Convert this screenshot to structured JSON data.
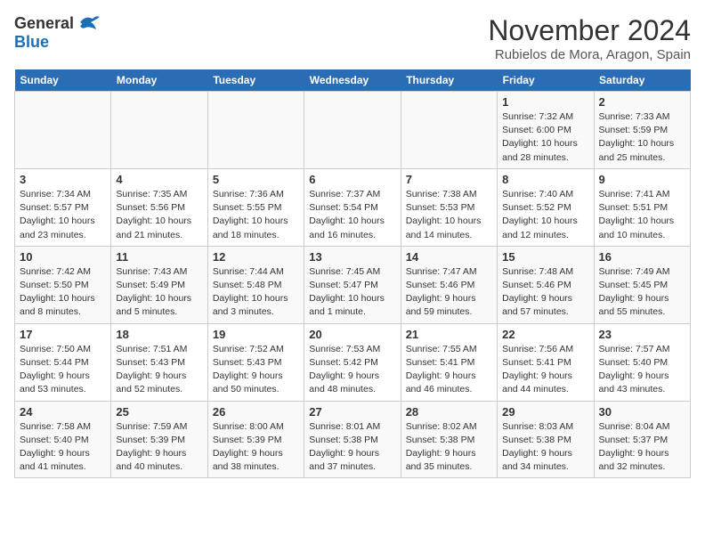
{
  "logo": {
    "general": "General",
    "blue": "Blue"
  },
  "title": "November 2024",
  "location": "Rubielos de Mora, Aragon, Spain",
  "weekdays": [
    "Sunday",
    "Monday",
    "Tuesday",
    "Wednesday",
    "Thursday",
    "Friday",
    "Saturday"
  ],
  "weeks": [
    [
      {
        "day": "",
        "info": ""
      },
      {
        "day": "",
        "info": ""
      },
      {
        "day": "",
        "info": ""
      },
      {
        "day": "",
        "info": ""
      },
      {
        "day": "",
        "info": ""
      },
      {
        "day": "1",
        "info": "Sunrise: 7:32 AM\nSunset: 6:00 PM\nDaylight: 10 hours and 28 minutes."
      },
      {
        "day": "2",
        "info": "Sunrise: 7:33 AM\nSunset: 5:59 PM\nDaylight: 10 hours and 25 minutes."
      }
    ],
    [
      {
        "day": "3",
        "info": "Sunrise: 7:34 AM\nSunset: 5:57 PM\nDaylight: 10 hours and 23 minutes."
      },
      {
        "day": "4",
        "info": "Sunrise: 7:35 AM\nSunset: 5:56 PM\nDaylight: 10 hours and 21 minutes."
      },
      {
        "day": "5",
        "info": "Sunrise: 7:36 AM\nSunset: 5:55 PM\nDaylight: 10 hours and 18 minutes."
      },
      {
        "day": "6",
        "info": "Sunrise: 7:37 AM\nSunset: 5:54 PM\nDaylight: 10 hours and 16 minutes."
      },
      {
        "day": "7",
        "info": "Sunrise: 7:38 AM\nSunset: 5:53 PM\nDaylight: 10 hours and 14 minutes."
      },
      {
        "day": "8",
        "info": "Sunrise: 7:40 AM\nSunset: 5:52 PM\nDaylight: 10 hours and 12 minutes."
      },
      {
        "day": "9",
        "info": "Sunrise: 7:41 AM\nSunset: 5:51 PM\nDaylight: 10 hours and 10 minutes."
      }
    ],
    [
      {
        "day": "10",
        "info": "Sunrise: 7:42 AM\nSunset: 5:50 PM\nDaylight: 10 hours and 8 minutes."
      },
      {
        "day": "11",
        "info": "Sunrise: 7:43 AM\nSunset: 5:49 PM\nDaylight: 10 hours and 5 minutes."
      },
      {
        "day": "12",
        "info": "Sunrise: 7:44 AM\nSunset: 5:48 PM\nDaylight: 10 hours and 3 minutes."
      },
      {
        "day": "13",
        "info": "Sunrise: 7:45 AM\nSunset: 5:47 PM\nDaylight: 10 hours and 1 minute."
      },
      {
        "day": "14",
        "info": "Sunrise: 7:47 AM\nSunset: 5:46 PM\nDaylight: 9 hours and 59 minutes."
      },
      {
        "day": "15",
        "info": "Sunrise: 7:48 AM\nSunset: 5:46 PM\nDaylight: 9 hours and 57 minutes."
      },
      {
        "day": "16",
        "info": "Sunrise: 7:49 AM\nSunset: 5:45 PM\nDaylight: 9 hours and 55 minutes."
      }
    ],
    [
      {
        "day": "17",
        "info": "Sunrise: 7:50 AM\nSunset: 5:44 PM\nDaylight: 9 hours and 53 minutes."
      },
      {
        "day": "18",
        "info": "Sunrise: 7:51 AM\nSunset: 5:43 PM\nDaylight: 9 hours and 52 minutes."
      },
      {
        "day": "19",
        "info": "Sunrise: 7:52 AM\nSunset: 5:43 PM\nDaylight: 9 hours and 50 minutes."
      },
      {
        "day": "20",
        "info": "Sunrise: 7:53 AM\nSunset: 5:42 PM\nDaylight: 9 hours and 48 minutes."
      },
      {
        "day": "21",
        "info": "Sunrise: 7:55 AM\nSunset: 5:41 PM\nDaylight: 9 hours and 46 minutes."
      },
      {
        "day": "22",
        "info": "Sunrise: 7:56 AM\nSunset: 5:41 PM\nDaylight: 9 hours and 44 minutes."
      },
      {
        "day": "23",
        "info": "Sunrise: 7:57 AM\nSunset: 5:40 PM\nDaylight: 9 hours and 43 minutes."
      }
    ],
    [
      {
        "day": "24",
        "info": "Sunrise: 7:58 AM\nSunset: 5:40 PM\nDaylight: 9 hours and 41 minutes."
      },
      {
        "day": "25",
        "info": "Sunrise: 7:59 AM\nSunset: 5:39 PM\nDaylight: 9 hours and 40 minutes."
      },
      {
        "day": "26",
        "info": "Sunrise: 8:00 AM\nSunset: 5:39 PM\nDaylight: 9 hours and 38 minutes."
      },
      {
        "day": "27",
        "info": "Sunrise: 8:01 AM\nSunset: 5:38 PM\nDaylight: 9 hours and 37 minutes."
      },
      {
        "day": "28",
        "info": "Sunrise: 8:02 AM\nSunset: 5:38 PM\nDaylight: 9 hours and 35 minutes."
      },
      {
        "day": "29",
        "info": "Sunrise: 8:03 AM\nSunset: 5:38 PM\nDaylight: 9 hours and 34 minutes."
      },
      {
        "day": "30",
        "info": "Sunrise: 8:04 AM\nSunset: 5:37 PM\nDaylight: 9 hours and 32 minutes."
      }
    ]
  ]
}
